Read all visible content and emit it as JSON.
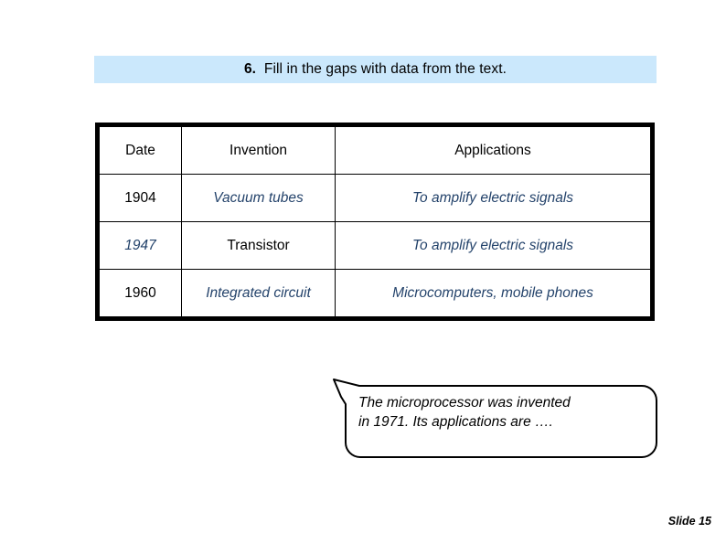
{
  "banner": {
    "number": "6.",
    "title": "Fill in the gaps with data from the text.",
    "background": "#cbe8fc"
  },
  "table": {
    "headers": [
      "Date",
      "Invention",
      "Applications"
    ],
    "answer_color": "#24436b",
    "plain_color": "#000000",
    "rows": [
      {
        "date": "1904",
        "date_style": "plain",
        "invention": "Vacuum tubes",
        "invention_style": "answer",
        "applications": "To amplify electric signals",
        "applications_style": "answer"
      },
      {
        "date": "1947",
        "date_style": "answer",
        "invention": "Transistor",
        "invention_style": "plain",
        "applications": "To amplify electric signals",
        "applications_style": "answer"
      },
      {
        "date": "1960",
        "date_style": "plain",
        "invention": "Integrated circuit",
        "invention_style": "answer",
        "applications": "Microcomputers, mobile phones",
        "applications_style": "answer"
      }
    ]
  },
  "bubble": {
    "line1": "The microprocessor was invented",
    "line2": "in 1971. Its applications are …."
  },
  "footer": {
    "slide_label": "Slide 15"
  }
}
